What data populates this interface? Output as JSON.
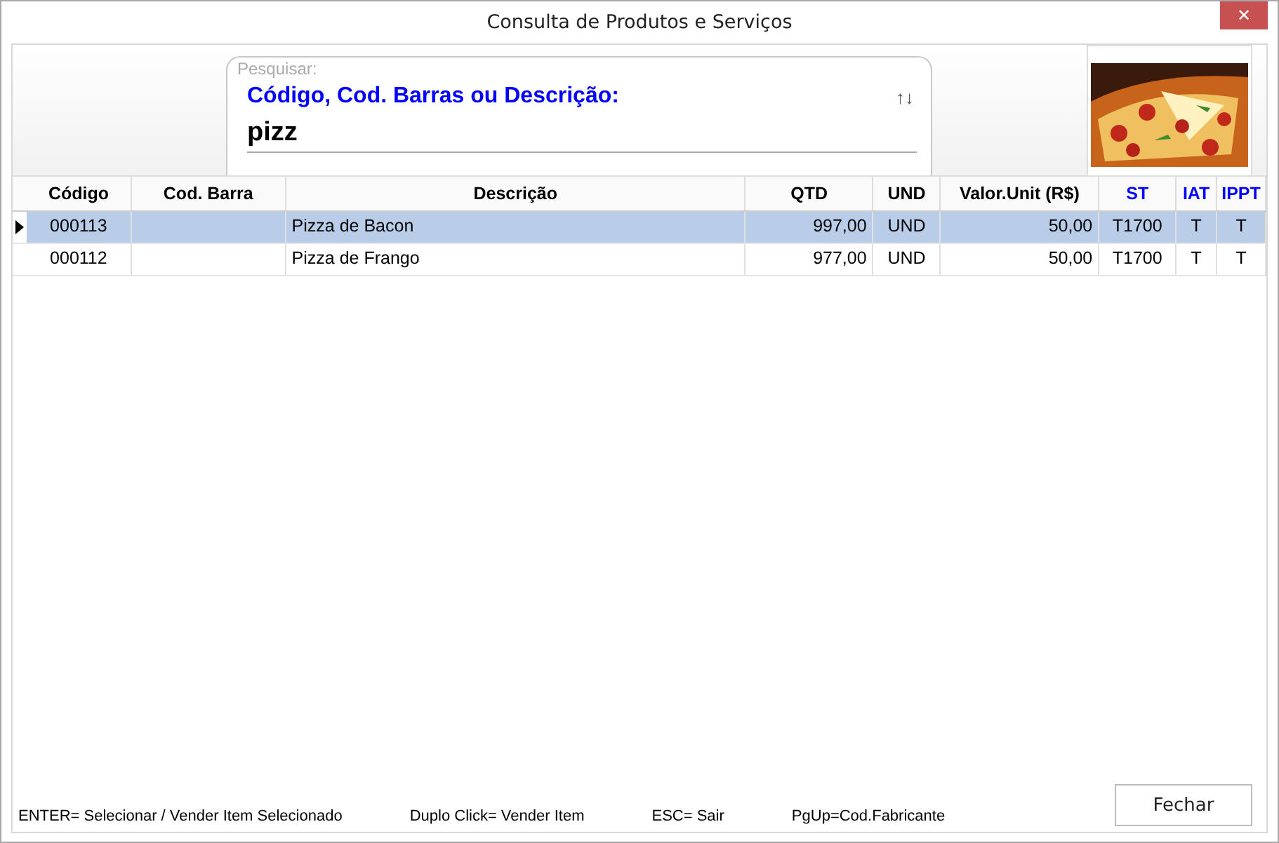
{
  "window": {
    "title": "Consulta de Produtos e Serviços",
    "close_button": "✕"
  },
  "search": {
    "caption": "Pesquisar:",
    "label": "Código, Cod. Barras ou Descrição:",
    "value": "pizz",
    "sort_icon": "↑↓"
  },
  "product_image": {
    "kind": "picture"
  },
  "table": {
    "columns": [
      {
        "label": "Código",
        "color": "#000000"
      },
      {
        "label": "Cod. Barra",
        "color": "#000000"
      },
      {
        "label": "Descrição",
        "color": "#000000"
      },
      {
        "label": "QTD",
        "color": "#000000"
      },
      {
        "label": "UND",
        "color": "#000000"
      },
      {
        "label": "Valor.Unit (R$)",
        "color": "#000000"
      },
      {
        "label": "ST",
        "color": "#0000ff"
      },
      {
        "label": "IAT",
        "color": "#0000ff"
      },
      {
        "label": "IPPT",
        "color": "#0000ff"
      }
    ],
    "rows": [
      {
        "selected": true,
        "cells": [
          "000113",
          "",
          "Pizza de Bacon",
          "997,00",
          "UND",
          "50,00",
          "T1700",
          "T",
          "T"
        ]
      },
      {
        "selected": false,
        "cells": [
          "000112",
          "",
          "Pizza de Frango",
          "977,00",
          "UND",
          "50,00",
          "T1700",
          "T",
          "T"
        ]
      }
    ]
  },
  "shortcuts": [
    "ENTER= Selecionar / Vender Item Selecionado",
    "Duplo Click= Vender Item",
    "ESC= Sair",
    "PgUp=Cod.Fabricante"
  ],
  "buttons": [
    "Fechar"
  ]
}
